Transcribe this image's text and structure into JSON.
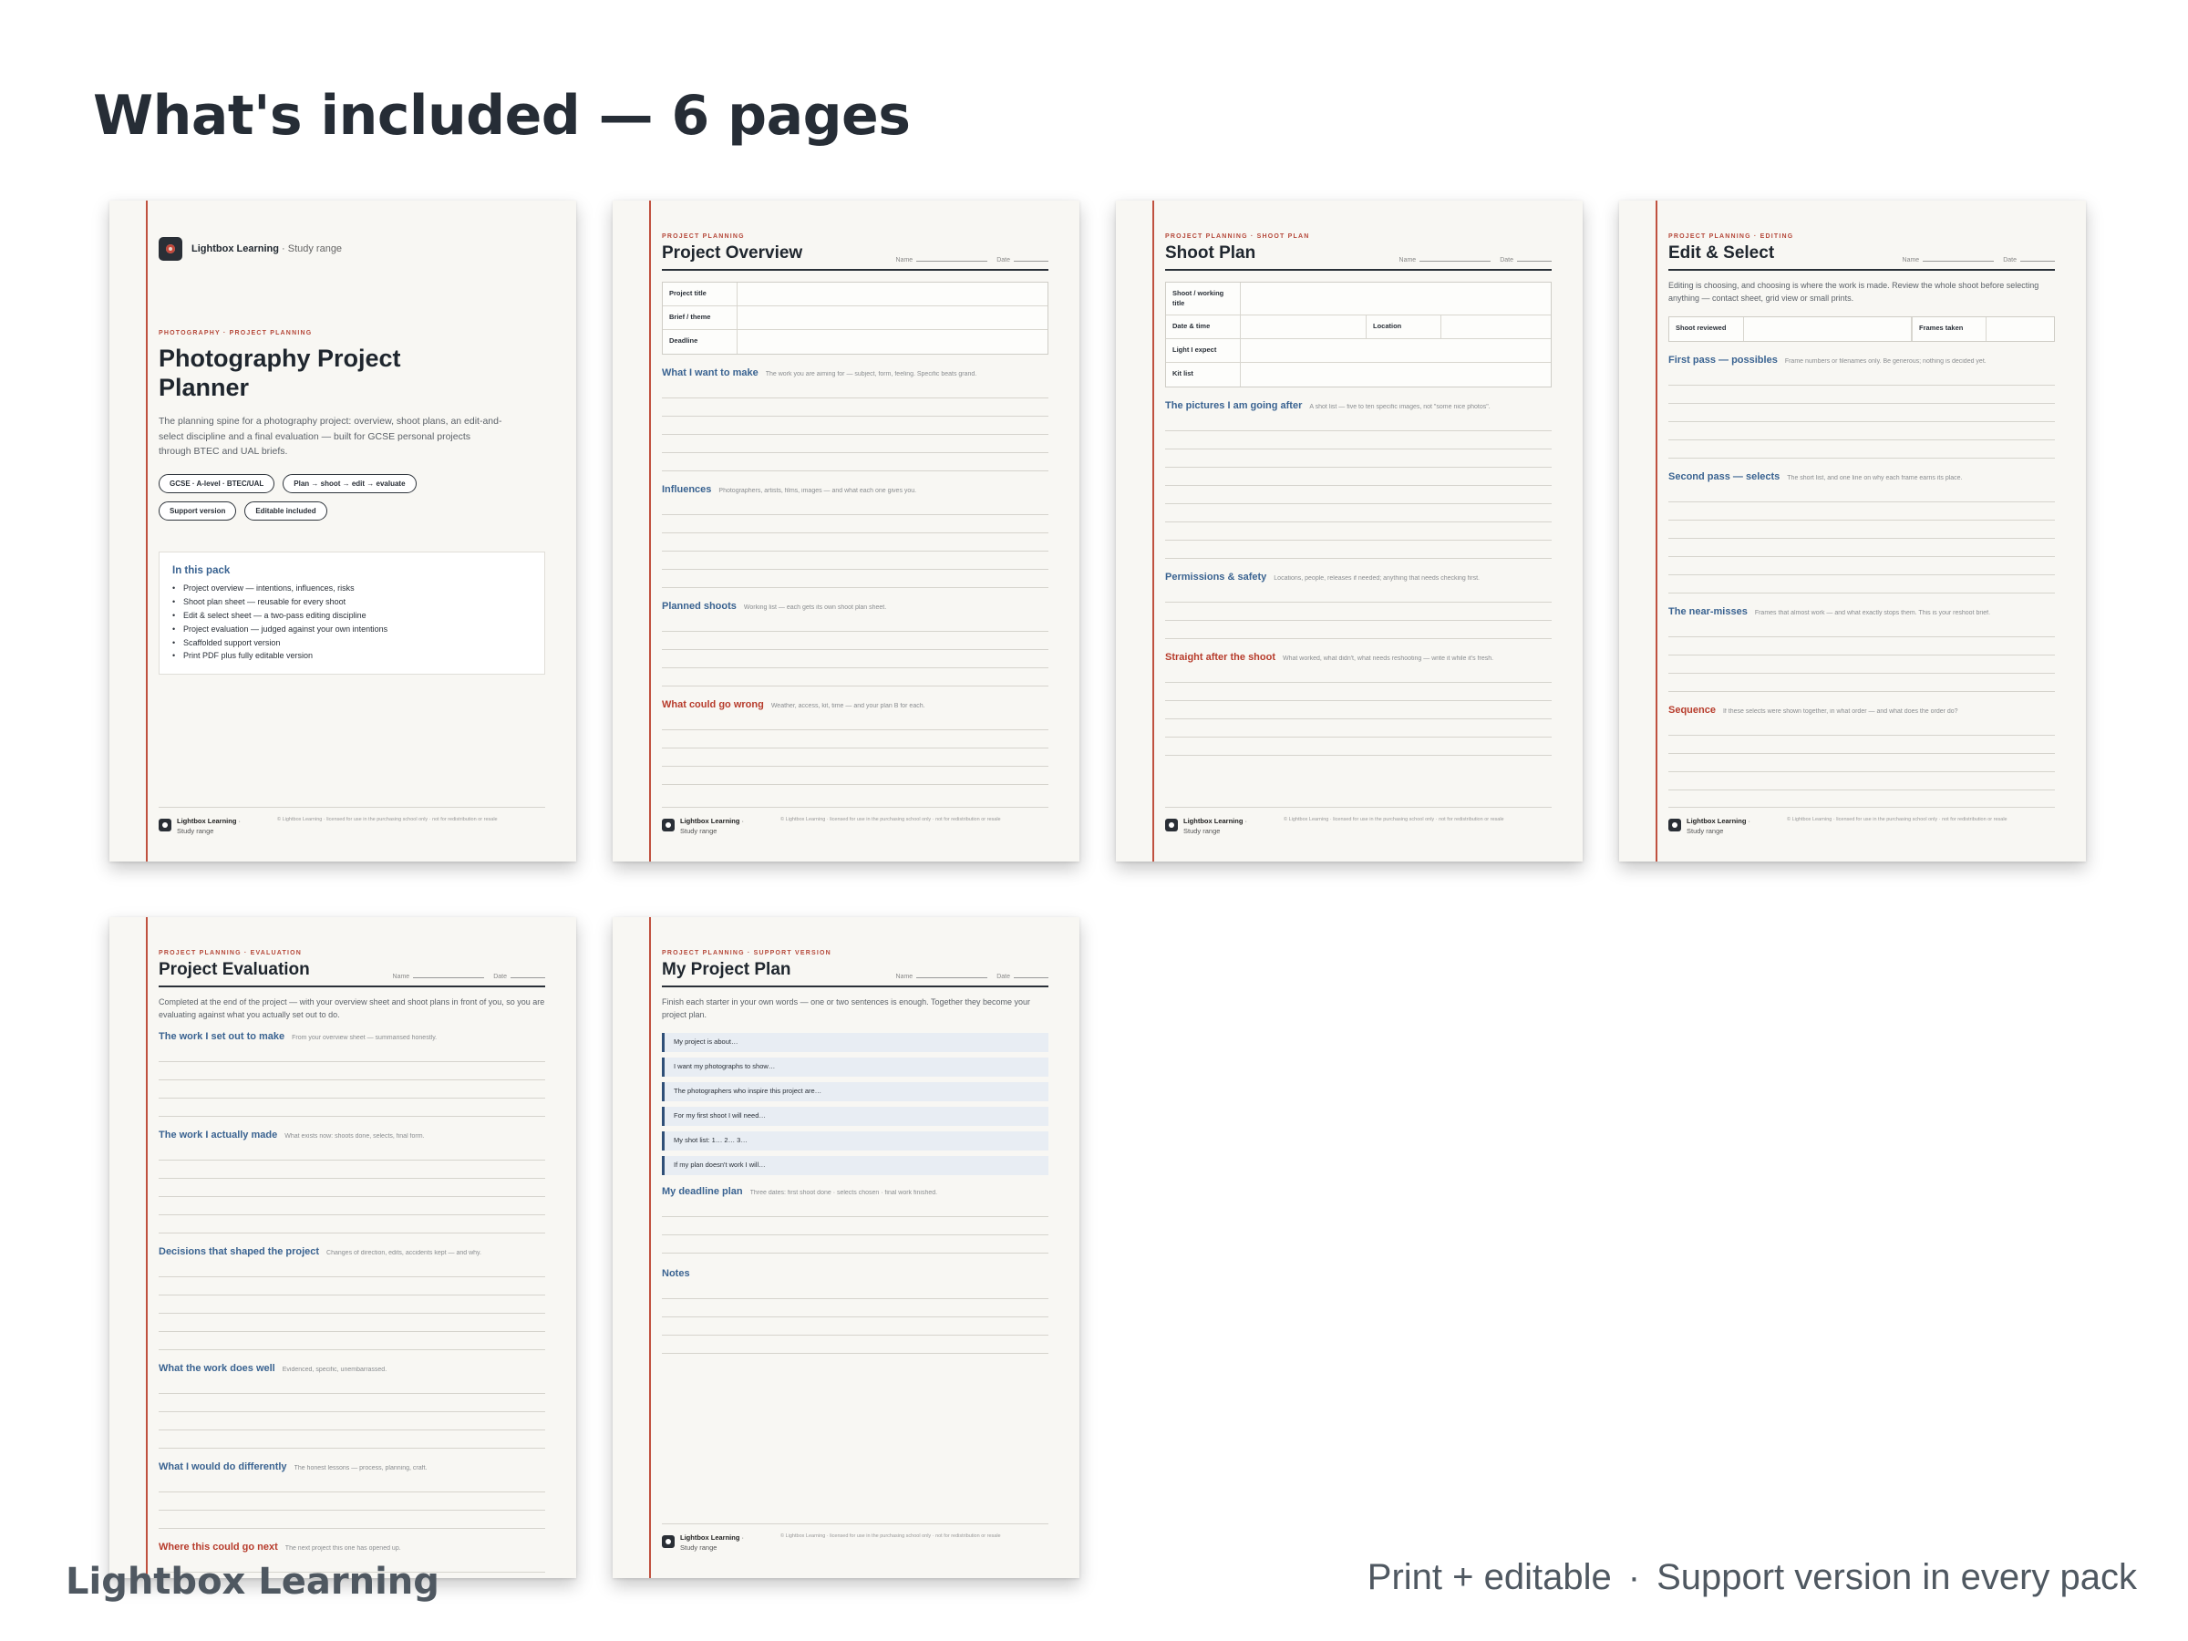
{
  "heading": "What's included — 6 pages",
  "bottom_brand": "Lightbox Learning",
  "tagline": {
    "left": "Print + editable",
    "sep": "·",
    "right": "Support version in every pack"
  },
  "footer": {
    "brand": "Lightbox Learning",
    "range": "· Study range",
    "license": "© Lightbox Learning · licensed for use in the purchasing school only · not for redistribution or resale"
  },
  "fields": {
    "name": "Name",
    "date": "Date"
  },
  "cover": {
    "brand": "Lightbox Learning",
    "brand_suffix": "· Study range",
    "kicker": "PHOTOGRAPHY · PROJECT PLANNING",
    "title": "Photography Project Planner",
    "description": "The planning spine for a photography project: overview, shoot plans, an edit-and-select discipline and a final evaluation — built for GCSE personal projects through BTEC and UAL briefs.",
    "pills": [
      "GCSE · A-level · BTEC/UAL",
      "Plan → shoot → edit → evaluate",
      "Support version",
      "Editable included"
    ],
    "pack_title": "In this pack",
    "pack_items": [
      "Project overview — intentions, influences, risks",
      "Shoot plan sheet — reusable for every shoot",
      "Edit & select sheet — a two-pass editing discipline",
      "Project evaluation — judged against your own intentions",
      "Scaffolded support version",
      "Print PDF plus fully editable version"
    ]
  },
  "overview": {
    "kicker": "PROJECT PLANNING",
    "title": "Project Overview",
    "table": [
      "Project title",
      "Brief / theme",
      "Deadline"
    ],
    "sections": [
      {
        "head": "What I want to make",
        "sub": "The work you are aiming for — subject, form, feeling. Specific beats grand.",
        "red": false
      },
      {
        "head": "Influences",
        "sub": "Photographers, artists, films, images — and what each one gives you.",
        "red": false
      },
      {
        "head": "Planned shoots",
        "sub": "Working list — each gets its own shoot plan sheet.",
        "red": false
      },
      {
        "head": "What could go wrong",
        "sub": "Weather, access, kit, time — and your plan B for each.",
        "red": true
      }
    ]
  },
  "shoot": {
    "kicker": "PROJECT PLANNING · SHOOT PLAN",
    "title": "Shoot Plan",
    "table": {
      "row1": "Shoot / working title",
      "row2a": "Date & time",
      "row2b": "Location",
      "row3": "Light I expect",
      "row4": "Kit list"
    },
    "sections": [
      {
        "head": "The pictures I am going after",
        "sub": "A shot list — five to ten specific images, not \"some nice photos\".",
        "red": false
      },
      {
        "head": "Permissions & safety",
        "sub": "Locations, people, releases if needed; anything that needs checking first.",
        "red": false
      },
      {
        "head": "Straight after the shoot",
        "sub": "What worked, what didn't, what needs reshooting — write it while it's fresh.",
        "red": true
      }
    ]
  },
  "edit": {
    "kicker": "PROJECT PLANNING · EDITING",
    "title": "Edit & Select",
    "intro": "Editing is choosing, and choosing is where the work is made. Review the whole shoot before selecting anything — contact sheet, grid view or small prints.",
    "table": {
      "a": "Shoot reviewed",
      "b": "Frames taken"
    },
    "sections": [
      {
        "head": "First pass — possibles",
        "sub": "Frame numbers or filenames only. Be generous; nothing is decided yet.",
        "red": false
      },
      {
        "head": "Second pass — selects",
        "sub": "The short list, and one line on why each frame earns its place.",
        "red": false
      },
      {
        "head": "The near-misses",
        "sub": "Frames that almost work — and what exactly stops them. This is your reshoot brief.",
        "red": false
      },
      {
        "head": "Sequence",
        "sub": "If these selects were shown together, in what order — and what does the order do?",
        "red": true
      }
    ]
  },
  "evaluation": {
    "kicker": "PROJECT PLANNING · EVALUATION",
    "title": "Project Evaluation",
    "intro": "Completed at the end of the project — with your overview sheet and shoot plans in front of you, so you are evaluating against what you actually set out to do.",
    "sections": [
      {
        "head": "The work I set out to make",
        "sub": "From your overview sheet — summarised honestly.",
        "red": false
      },
      {
        "head": "The work I actually made",
        "sub": "What exists now: shoots done, selects, final form.",
        "red": false
      },
      {
        "head": "Decisions that shaped the project",
        "sub": "Changes of direction, edits, accidents kept — and why.",
        "red": false
      },
      {
        "head": "What the work does well",
        "sub": "Evidenced, specific, unembarrassed.",
        "red": false
      },
      {
        "head": "What I would do differently",
        "sub": "The honest lessons — process, planning, craft.",
        "red": false
      },
      {
        "head": "Where this could go next",
        "sub": "The next project this one has opened up.",
        "red": true
      }
    ]
  },
  "support": {
    "kicker": "PROJECT PLANNING · SUPPORT VERSION",
    "title": "My Project Plan",
    "intro": "Finish each starter in your own words — one or two sentences is enough. Together they become your project plan.",
    "prompts": [
      "My project is about…",
      "I want my photographs to show…",
      "The photographers who inspire this project are…",
      "For my first shoot I will need…",
      "My shot list: 1… 2… 3…",
      "If my plan doesn't work I will…"
    ],
    "deadline_head": "My deadline plan",
    "deadline_sub": "Three dates: first shoot done · selects chosen · final work finished.",
    "notes_head": "Notes"
  }
}
